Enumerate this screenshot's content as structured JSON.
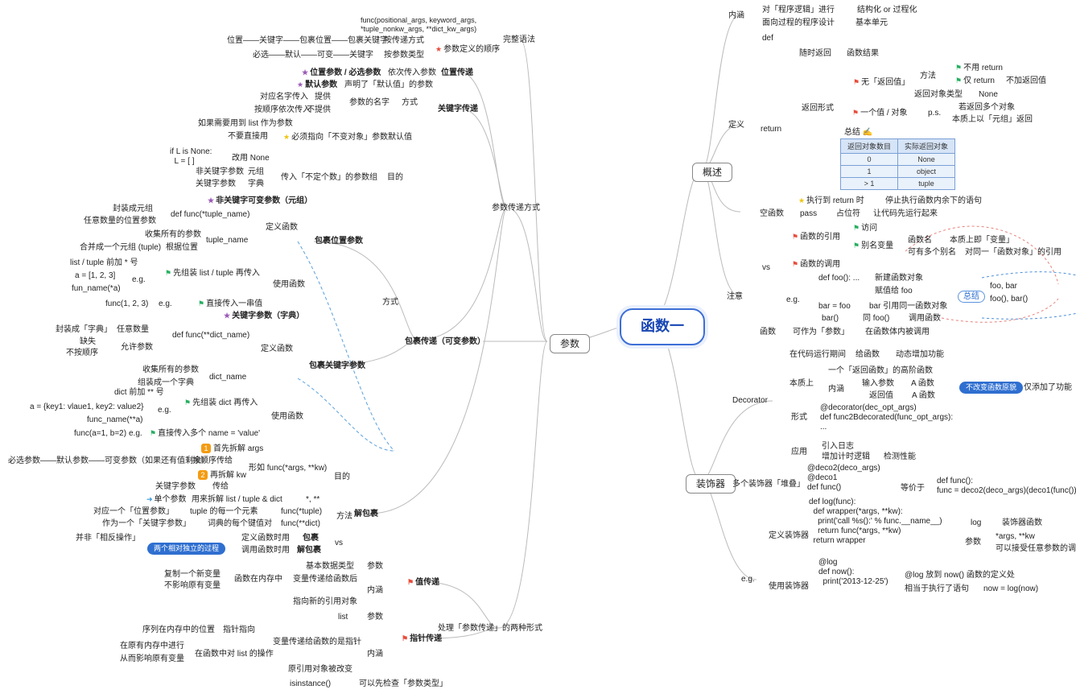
{
  "root": "函数一",
  "level1": {
    "parameters": "参数",
    "overview": "概述",
    "decorator": "装饰器"
  },
  "params": {
    "full_syntax": "完整语法",
    "func_sig": "func(positional_args, keyword_args,\n*tuple_nonkw_args, **dict_kw_args)",
    "order": "参数定义的顺序",
    "order_row1_left": "位置——关键字——包裹位置——包裹关键字",
    "order_row1_right": "按传递方式",
    "order_row2_left": "必选——默认——可变——关键字",
    "order_row2_right": "按参数类型",
    "passing": "参数传递方式",
    "positional": "位置传递",
    "positional_desc": "依次传入参数",
    "positional_required": "位置参数 / 必选参数",
    "keyword": "关键字传递",
    "default_param": "默认参数",
    "default_param_desc": "声明了「默认值」的参数",
    "kw_name": "参数的名字",
    "kw_mode": "方式",
    "kw_byname": "对应名字传入",
    "kw_provide": "提供",
    "kw_byorder": "按顺序依次传入",
    "kw_noprovide": "不提供",
    "default_point": "必须指向「不变对象」",
    "default_point_label": "参数默认值",
    "list_as_param": "如果需要用到 list 作为参数",
    "no_direct": "不要直接用",
    "use_none": "改用 None",
    "if_none": "if L is None:\n  L = [ ]",
    "pack": "包裹传递（可变参数）",
    "pack_mode": "方式",
    "pack_purpose": "目的",
    "pack_purpose_desc": "传入「不定个数」的参数组",
    "pack_purpose_nonkw": "非关键字参数",
    "pack_purpose_tuple": "元组",
    "pack_purpose_kw": "关键字参数",
    "pack_purpose_dict": "字典",
    "nonkw_var": "非关键字可变参数（元组）",
    "pack_pos": "包裹位置参数",
    "def_func": "定义函数",
    "def_tuple": "def func(*tuple_name)",
    "def_tuple_a": "封装成元组",
    "def_tuple_b": "任意数量的位置参数",
    "tuple_name": "tuple_name",
    "tuple_name_a": "收集所有的参数",
    "tuple_name_b": "合并成一个元组 (tuple)",
    "tuple_name_c": "根据位置",
    "use_func": "使用函数",
    "use_tuple_pack": "先组装 list / tuple 再传入",
    "use_tuple_eg": "e.g.",
    "use_tuple_a": "list / tuple 前加 * 号",
    "use_tuple_b": "a = [1, 2, 3]",
    "use_tuple_c": "fun_name(*a)",
    "use_tuple_direct": "直接传入一串值",
    "use_tuple_direct_eg": "func(1, 2, 3)",
    "kw_var": "关键字参数（字典）",
    "pack_kw": "包裹关键字参数",
    "def_dict": "def func(**dict_name)",
    "def_dict_a": "封装成「字典」",
    "def_dict_b": "任意数量",
    "def_dict_c": "缺失",
    "def_dict_d": "允许参数",
    "def_dict_e": "不按顺序",
    "dict_name": "dict_name",
    "dict_name_a": "收集所有的参数",
    "dict_name_b": "组装成一个字典",
    "use_dict_pack": "先组装 dict 再传入",
    "use_dict_a": "dict 前加 ** 号",
    "use_dict_b": "a = {key1: vlaue1, key2: value2}",
    "use_dict_c": "func_name(**a)",
    "use_dict_direct": "直接传入多个 name = 'value'",
    "use_dict_direct_eg": "func(a=1, b=2)",
    "unpack": "解包裹",
    "unpack_purpose_label": "目的",
    "unpack_purpose_eg": "形如 func(*args, **kw)",
    "unpack_step1": "首先拆解 args",
    "unpack_step2": "再拆解 kw",
    "unpack_order": "按顺序传给",
    "unpack_chain": "必选参数——默认参数——可变参数（如果还有值剩余）",
    "unpack_kw": "关键字参数",
    "unpack_pass": "传给",
    "unpack_method": "方法",
    "unpack_star": "*, **",
    "unpack_star_desc": "用来拆解 list / tuple & dict",
    "unpack_star_single": "单个参数",
    "unpack_f_tuple": "func(*tuple)",
    "unpack_f_tuple_a": "tuple 的每一个元素",
    "unpack_f_tuple_b": "对应一个「位置参数」",
    "unpack_f_dict": "func(**dict)",
    "unpack_f_dict_a": "词典的每个键值对",
    "unpack_f_dict_b": "作为一个「关键字参数」",
    "unpack_vs": "vs",
    "unpack_vs_pack": "包裹",
    "unpack_vs_pack_when": "定义函数时用",
    "unpack_vs_unpack": "解包裹",
    "unpack_vs_unpack_when": "调用函数时用",
    "unpack_not_reverse": "并非「相反操作」",
    "unpack_independent": "两个相对独立的过程",
    "two_forms": "处理「参数传递」的两种形式",
    "val_pass": "值传递",
    "val_basic": "基本数据类型",
    "val_param": "参数",
    "val_inner": "内涵",
    "val_copy": "复制一个新变量",
    "val_noaffect": "不影响原有变量",
    "val_after": "函数在内存中",
    "val_after2": "变量传递给函数后",
    "val_point": "指向新的引用对象",
    "ptr_pass": "指针传递",
    "ptr_list": "list",
    "ptr_inner": "内涵",
    "ptr_seq": "序列在内存中的位置",
    "ptr_point": "指针指向",
    "ptr_after": "变量传递给函数的是指针",
    "ptr_opin": "在原有内存中进行",
    "ptr_oplist": "在函数中对 list 的操作",
    "ptr_affect": "从而影响原有变量",
    "ptr_origin": "原引用对象被改变",
    "ptr_isinstance": "isinstance()",
    "ptr_check": "可以先检查「参数类型」"
  },
  "over": {
    "head": "概述",
    "connotation": "内涵",
    "conn_a": "对「程序逻辑」进行",
    "conn_b": "结构化 or 过程化",
    "conn_c": "面向过程的程序设计",
    "conn_d": "基本单元",
    "define": "定义",
    "def_kw": "def",
    "return": "return",
    "ret_random": "随时返回",
    "ret_result": "函数结果",
    "ret_form": "返回形式",
    "ret_none": "无「返回值」",
    "ret_none_a": "方法",
    "ret_none_b": "不用 return",
    "ret_none_c": "仅 return",
    "ret_none_d": "不加返回值",
    "ret_none_e": "返回对象类型",
    "ret_none_f": "None",
    "ret_one": "一个值 / 对象",
    "ret_one_ps": "p.s.",
    "ret_one_a": "若返回多个对象",
    "ret_one_b": "本质上以「元组」返回",
    "ret_sum": "总结 ✍️",
    "tbl_h1": "实际返回对象",
    "tbl_h2": "返回对象数目",
    "tbl_r1a": "0",
    "tbl_r1b": "None",
    "tbl_r2a": "1",
    "tbl_r2b": "object",
    "tbl_r3a": ">  1",
    "tbl_r3b": "tuple",
    "ret_exec": "执行到 return 时",
    "ret_exec_desc": "停止执行函数内余下的语句",
    "empty_func": "空函数",
    "pass": "pass",
    "pass_a": "占位符",
    "pass_b": "让代码先运行起来",
    "note": "注意",
    "vs": "vs",
    "ref": "函数的引用",
    "ref_access": "访问",
    "ref_alias": "别名变量",
    "ref_alias_a": "函数名",
    "ref_alias_b": "本质上即「变量」",
    "ref_alias_c": "可有多个别名",
    "ref_alias_d": "对同一「函数对象」的引用",
    "call": "函数的调用",
    "call_eg": "e.g.",
    "call_def": "def foo(): ...",
    "call_new": "新建函数对象",
    "call_bar": "bar = foo",
    "call_bar_a": "赋值给 foo",
    "call_bar_b": "bar 引用同一函数对象",
    "call_bar2": "bar()",
    "call_bar2_a": "同 foo()",
    "call_bar2_b": "调用函数",
    "call_sum": "总结",
    "call_sum_a": "foo, bar",
    "call_sum_b": "foo(), bar()",
    "as_param": "函数",
    "as_param_a": "可作为「参数」",
    "as_param_b": "在函数体内被调用"
  },
  "deco": {
    "label": "Decorator",
    "d_a": "在代码运行期间",
    "d_b": "给函数",
    "d_c": "动态增加功能",
    "essence": "本质上",
    "ess_a": "一个「返回函数」的高阶函数",
    "ess_b": "内涵",
    "ess_c": "输入参数",
    "ess_d": "A 函数",
    "ess_e": "返回值",
    "ess_f": "A 函数",
    "ess_tag": "不改变函数原貌",
    "ess_tag2": "仅添加了功能",
    "form": "形式",
    "form_a": "@decorator(dec_opt_args)\ndef func2Bdecorated(func_opt_args):\n...",
    "use": "应用",
    "use_a": "引入日志",
    "use_b": "增加计时逻辑",
    "use_c": "检测性能",
    "stack": "多个装饰器「堆叠」",
    "stack_a": "@deco2(deco_args)\n@deco1\ndef func()",
    "stack_eq": "等价于",
    "stack_b": "def func():\nfunc = deco2(deco_args)(deco1(func()))",
    "eg": "e.g.",
    "eg_def": "定义装饰器",
    "eg_def_code": "def log(func):\n  def wrapper(*args, **kw):\n    print('call %s():' % func.__name__)\n    return func(*args, **kw)\n  return wrapper",
    "eg_log": "log",
    "eg_log_a": "装饰器函数",
    "eg_args": "参数",
    "eg_args_a": "*args, **kw",
    "eg_args_b": "可以接受任意参数的调用",
    "eg_use": "使用装饰器",
    "eg_use_code": "@log\ndef now():\n  print('2013-12-25')",
    "eg_use_a": "@log 放到 now() 函数的定义处",
    "eg_use_b": "相当于执行了语句",
    "eg_use_c": "now = log(now)"
  }
}
